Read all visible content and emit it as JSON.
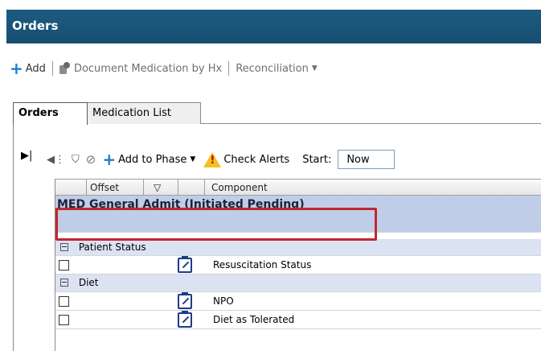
{
  "window": {
    "title": "Orders"
  },
  "toolbar": {
    "add_label": "Add",
    "document_med_label": "Document Medication by Hx",
    "reconciliation_label": "Reconciliation"
  },
  "tabs": [
    {
      "label": "Orders",
      "active": true
    },
    {
      "label": "Medication List",
      "active": false
    }
  ],
  "inner_toolbar": {
    "add_to_phase_label": "Add to Phase",
    "check_alerts_label": "Check Alerts",
    "start_label": "Start:",
    "start_value": "Now"
  },
  "grid": {
    "columns": [
      "Offset",
      "Component"
    ],
    "phase_title": "MED General Admit (Initiated Pending)",
    "sections": [
      {
        "name": "Patient Status",
        "items": [
          "Resuscitation Status"
        ]
      },
      {
        "name": "Diet",
        "items": [
          "NPO",
          "Diet as Tolerated"
        ]
      }
    ]
  },
  "colors": {
    "title_bar": "#1d5a80",
    "phase_row": "#bfcde9",
    "highlight": "#c1272d",
    "add_icon": "#1b7fd6"
  }
}
